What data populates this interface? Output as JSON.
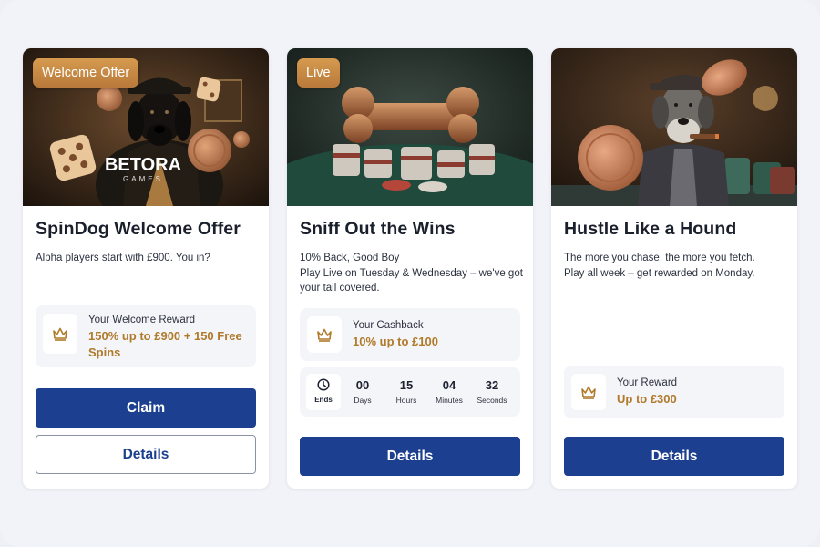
{
  "cards": [
    {
      "badge": "Welcome Offer",
      "hero_logo": "BETORA",
      "hero_logo_sub": "GAMES",
      "title": "SpinDog Welcome Offer",
      "description": [
        "Alpha players start with £900. You in?"
      ],
      "reward_label": "Your Welcome Reward",
      "reward_value": "150% up to £900 + 150 Free Spins",
      "reward_icon": "crown-icon",
      "primary_button": "Claim",
      "secondary_button": "Details"
    },
    {
      "badge": "Live",
      "title": "Sniff Out the Wins",
      "description": [
        "10% Back, Good Boy",
        "Play Live on Tuesday & Wednesday – we've got your tail covered."
      ],
      "reward_label": "Your Cashback",
      "reward_value": "10% up to £100",
      "reward_icon": "crown-icon",
      "countdown": {
        "ends_label": "Ends",
        "ends_icon": "clock-icon",
        "units": [
          {
            "value": "00",
            "label": "Days"
          },
          {
            "value": "15",
            "label": "Hours"
          },
          {
            "value": "04",
            "label": "Minutes"
          },
          {
            "value": "32",
            "label": "Seconds"
          }
        ]
      },
      "primary_button": "Details"
    },
    {
      "title": "Hustle Like a Hound",
      "description": [
        "The more you chase, the more you fetch.",
        "Play all week – get rewarded on Monday."
      ],
      "reward_label": "Your Reward",
      "reward_value": "Up to £300",
      "reward_icon": "crown-icon",
      "primary_button": "Details"
    }
  ],
  "colors": {
    "accent_gold": "#b07a2a",
    "button_blue": "#1c3f8f",
    "badge_gold": "#c98a45"
  }
}
